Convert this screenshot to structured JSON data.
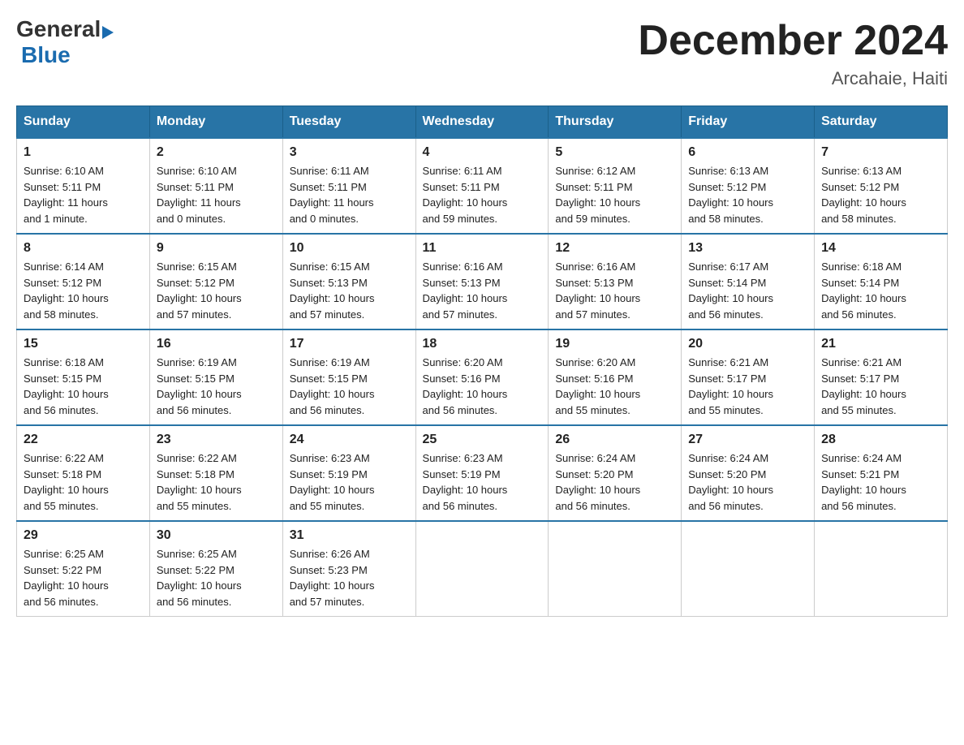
{
  "logo": {
    "general": "General",
    "blue": "Blue",
    "arrow": "▶"
  },
  "title": "December 2024",
  "subtitle": "Arcahaie, Haiti",
  "days_of_week": [
    "Sunday",
    "Monday",
    "Tuesday",
    "Wednesday",
    "Thursday",
    "Friday",
    "Saturday"
  ],
  "weeks": [
    [
      {
        "day": "1",
        "sunrise": "6:10 AM",
        "sunset": "5:11 PM",
        "daylight": "11 hours and 1 minute."
      },
      {
        "day": "2",
        "sunrise": "6:10 AM",
        "sunset": "5:11 PM",
        "daylight": "11 hours and 0 minutes."
      },
      {
        "day": "3",
        "sunrise": "6:11 AM",
        "sunset": "5:11 PM",
        "daylight": "11 hours and 0 minutes."
      },
      {
        "day": "4",
        "sunrise": "6:11 AM",
        "sunset": "5:11 PM",
        "daylight": "10 hours and 59 minutes."
      },
      {
        "day": "5",
        "sunrise": "6:12 AM",
        "sunset": "5:11 PM",
        "daylight": "10 hours and 59 minutes."
      },
      {
        "day": "6",
        "sunrise": "6:13 AM",
        "sunset": "5:12 PM",
        "daylight": "10 hours and 58 minutes."
      },
      {
        "day": "7",
        "sunrise": "6:13 AM",
        "sunset": "5:12 PM",
        "daylight": "10 hours and 58 minutes."
      }
    ],
    [
      {
        "day": "8",
        "sunrise": "6:14 AM",
        "sunset": "5:12 PM",
        "daylight": "10 hours and 58 minutes."
      },
      {
        "day": "9",
        "sunrise": "6:15 AM",
        "sunset": "5:12 PM",
        "daylight": "10 hours and 57 minutes."
      },
      {
        "day": "10",
        "sunrise": "6:15 AM",
        "sunset": "5:13 PM",
        "daylight": "10 hours and 57 minutes."
      },
      {
        "day": "11",
        "sunrise": "6:16 AM",
        "sunset": "5:13 PM",
        "daylight": "10 hours and 57 minutes."
      },
      {
        "day": "12",
        "sunrise": "6:16 AM",
        "sunset": "5:13 PM",
        "daylight": "10 hours and 57 minutes."
      },
      {
        "day": "13",
        "sunrise": "6:17 AM",
        "sunset": "5:14 PM",
        "daylight": "10 hours and 56 minutes."
      },
      {
        "day": "14",
        "sunrise": "6:18 AM",
        "sunset": "5:14 PM",
        "daylight": "10 hours and 56 minutes."
      }
    ],
    [
      {
        "day": "15",
        "sunrise": "6:18 AM",
        "sunset": "5:15 PM",
        "daylight": "10 hours and 56 minutes."
      },
      {
        "day": "16",
        "sunrise": "6:19 AM",
        "sunset": "5:15 PM",
        "daylight": "10 hours and 56 minutes."
      },
      {
        "day": "17",
        "sunrise": "6:19 AM",
        "sunset": "5:15 PM",
        "daylight": "10 hours and 56 minutes."
      },
      {
        "day": "18",
        "sunrise": "6:20 AM",
        "sunset": "5:16 PM",
        "daylight": "10 hours and 56 minutes."
      },
      {
        "day": "19",
        "sunrise": "6:20 AM",
        "sunset": "5:16 PM",
        "daylight": "10 hours and 55 minutes."
      },
      {
        "day": "20",
        "sunrise": "6:21 AM",
        "sunset": "5:17 PM",
        "daylight": "10 hours and 55 minutes."
      },
      {
        "day": "21",
        "sunrise": "6:21 AM",
        "sunset": "5:17 PM",
        "daylight": "10 hours and 55 minutes."
      }
    ],
    [
      {
        "day": "22",
        "sunrise": "6:22 AM",
        "sunset": "5:18 PM",
        "daylight": "10 hours and 55 minutes."
      },
      {
        "day": "23",
        "sunrise": "6:22 AM",
        "sunset": "5:18 PM",
        "daylight": "10 hours and 55 minutes."
      },
      {
        "day": "24",
        "sunrise": "6:23 AM",
        "sunset": "5:19 PM",
        "daylight": "10 hours and 55 minutes."
      },
      {
        "day": "25",
        "sunrise": "6:23 AM",
        "sunset": "5:19 PM",
        "daylight": "10 hours and 56 minutes."
      },
      {
        "day": "26",
        "sunrise": "6:24 AM",
        "sunset": "5:20 PM",
        "daylight": "10 hours and 56 minutes."
      },
      {
        "day": "27",
        "sunrise": "6:24 AM",
        "sunset": "5:20 PM",
        "daylight": "10 hours and 56 minutes."
      },
      {
        "day": "28",
        "sunrise": "6:24 AM",
        "sunset": "5:21 PM",
        "daylight": "10 hours and 56 minutes."
      }
    ],
    [
      {
        "day": "29",
        "sunrise": "6:25 AM",
        "sunset": "5:22 PM",
        "daylight": "10 hours and 56 minutes."
      },
      {
        "day": "30",
        "sunrise": "6:25 AM",
        "sunset": "5:22 PM",
        "daylight": "10 hours and 56 minutes."
      },
      {
        "day": "31",
        "sunrise": "6:26 AM",
        "sunset": "5:23 PM",
        "daylight": "10 hours and 57 minutes."
      },
      null,
      null,
      null,
      null
    ]
  ],
  "labels": {
    "sunrise": "Sunrise:",
    "sunset": "Sunset:",
    "daylight": "Daylight:"
  }
}
